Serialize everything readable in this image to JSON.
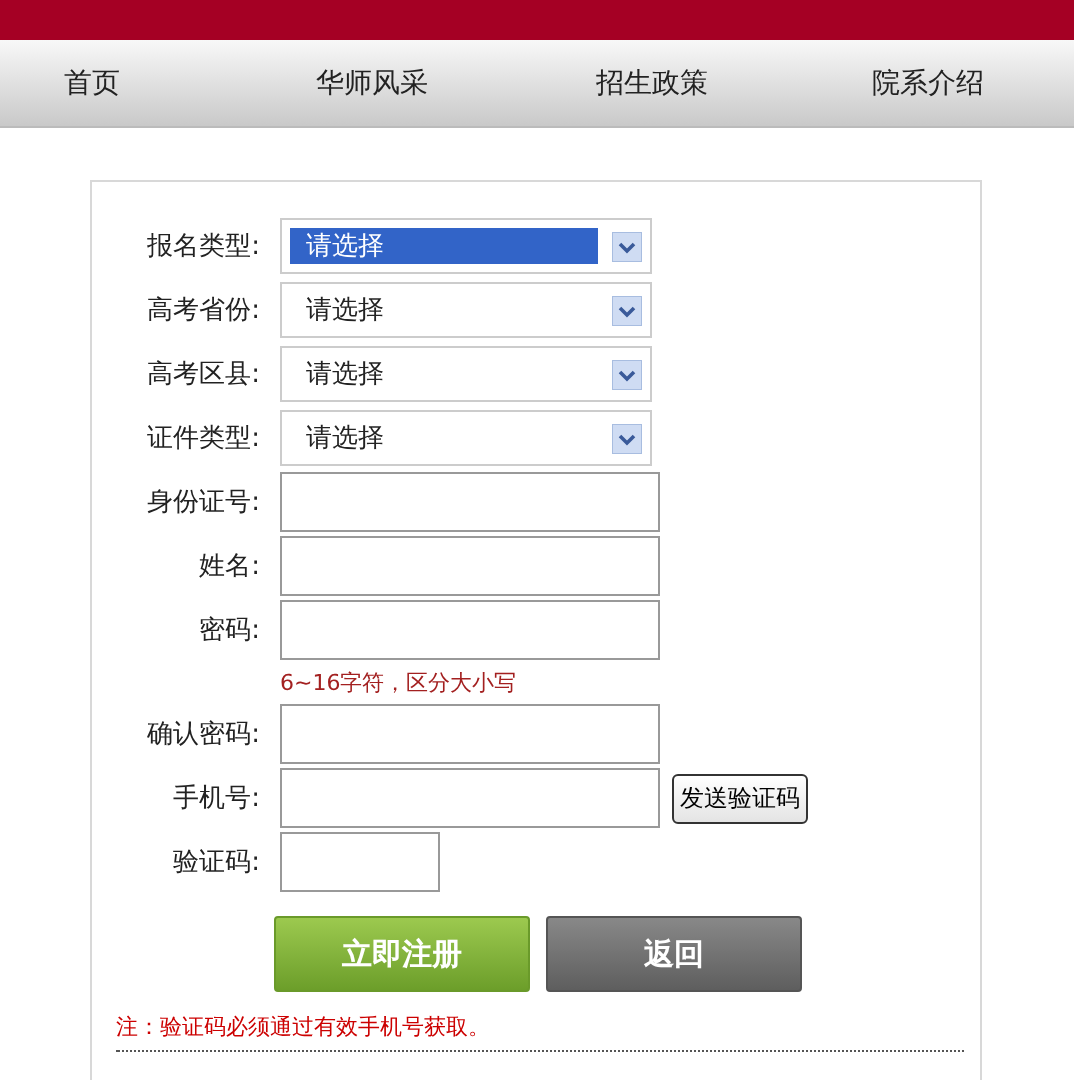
{
  "nav": [
    {
      "label": "首页"
    },
    {
      "label": "华师风采"
    },
    {
      "label": "招生政策"
    },
    {
      "label": "院系介绍"
    }
  ],
  "form": {
    "fields": [
      {
        "kind": "select",
        "label": "报名类型:",
        "value": "请选择",
        "highlighted": true
      },
      {
        "kind": "select",
        "label": "高考省份:",
        "value": "请选择",
        "highlighted": false
      },
      {
        "kind": "select",
        "label": "高考区县:",
        "value": "请选择",
        "highlighted": false
      },
      {
        "kind": "select",
        "label": "证件类型:",
        "value": "请选择",
        "highlighted": false
      },
      {
        "kind": "text",
        "label": "身份证号:"
      },
      {
        "kind": "text",
        "label": "姓名:"
      },
      {
        "kind": "text",
        "label": "密码:",
        "hint": "6~16字符，区分大小写"
      },
      {
        "kind": "text",
        "label": "确认密码:"
      },
      {
        "kind": "text",
        "label": "手机号:",
        "button": "发送验证码"
      },
      {
        "kind": "short",
        "label": "验证码:"
      }
    ],
    "buttons": [
      {
        "kind": "primary",
        "label": "立即注册"
      },
      {
        "kind": "secondary",
        "label": "返回"
      }
    ],
    "note": "注：验证码必须通过有效手机号获取。"
  }
}
